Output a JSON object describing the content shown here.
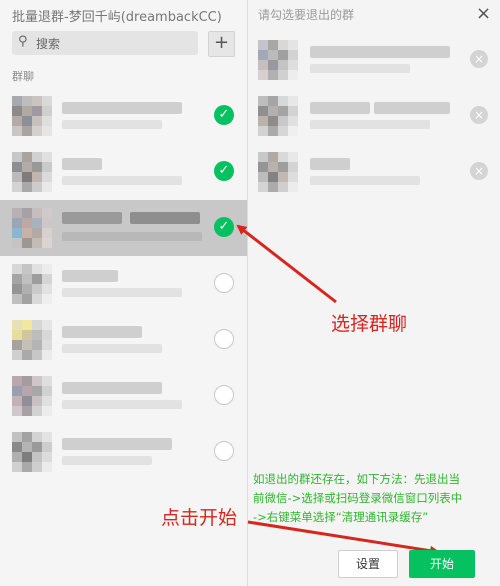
{
  "window": {
    "title": "批量退群-梦回千屿(dreambackCC)",
    "right_title": "请勾选要退出的群",
    "close_glyph": "×"
  },
  "search": {
    "label": "搜索",
    "icon": "search-icon"
  },
  "add_button": {
    "label": "+"
  },
  "section_label": "群聊",
  "group_rows": [
    {
      "checked": true
    },
    {
      "checked": true
    },
    {
      "checked": true,
      "highlighted": true
    },
    {
      "checked": false
    },
    {
      "checked": false
    },
    {
      "checked": false
    },
    {
      "checked": false
    }
  ],
  "selected_groups_count": 3,
  "remove_glyph": "×",
  "check_glyph": "✓",
  "note": {
    "line1": "如退出的群还存在，如下方法：先退出当",
    "line2": "前微信->选择或扫码登录微信窗口列表中",
    "line3": "->右键菜单选择“清理通讯录缓存”"
  },
  "annotations": {
    "select": "选择群聊",
    "start": "点击开始"
  },
  "buttons": {
    "settings": "设置",
    "start": "开始"
  },
  "colors": {
    "accent_green": "#07c160",
    "annotation_red": "#d7261e",
    "note_green": "#2fb52f"
  }
}
